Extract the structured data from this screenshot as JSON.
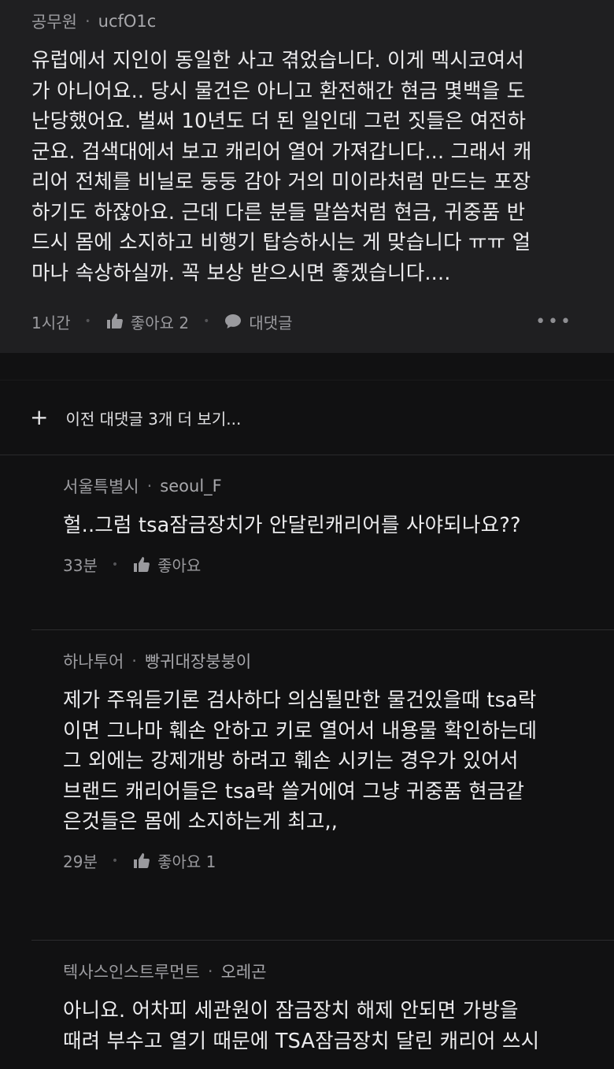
{
  "top_comment": {
    "author": "공무원",
    "nickname": "ucfO1c",
    "body": "유럽에서 지인이 동일한 사고 겪었습니다. 이게 멕시코여서\n가 아니어요.. 당시 물건은 아니고 환전해간 현금 몇백을 도\n난당했어요. 벌써 10년도 더 된 일인데 그런 짓들은 여전하\n군요. 검색대에서 보고 캐리어 열어 가져갑니다... 그래서 캐\n리어 전체를 비닐로 둥둥 감아 거의 미이라처럼 만드는 포장\n하기도 하잖아요. 근데 다른 분들 말씀처럼 현금, 귀중품 반\n드시 몸에 소지하고 비행기 탑승하시는 게 맞습니다 ㅠㅠ 얼\n마나 속상하실까. 꼭 보상 받으시면 좋겠습니다....",
    "time": "1시간",
    "like_label": "좋아요 2",
    "reply_label": "대댓글",
    "more_label": "•••"
  },
  "more_replies": {
    "plus": "+",
    "label": "이전 대댓글 3개 더 보기..."
  },
  "replies": [
    {
      "author": "서울특별시",
      "nickname": "seoul_F",
      "body": "헐..그럼 tsa잠금장치가 안달린캐리어를 사야되나요??",
      "time": "33분",
      "like_label": "좋아요"
    },
    {
      "author": "하나투어",
      "nickname": "빵귀대장붕붕이",
      "body": "제가 주워듣기론 검사하다 의심될만한 물건있을때 tsa락\n이면 그나마 훼손 안하고 키로 열어서 내용물 확인하는데\n그 외에는 강제개방 하려고 훼손 시키는 경우가 있어서\n브랜드 캐리어들은 tsa락 쓸거에여 그냥 귀중품 현금같\n은것들은 몸에 소지하는게 최고,,",
      "time": "29분",
      "like_label": "좋아요 1"
    },
    {
      "author": "텍사스인스트루먼트",
      "nickname": "오레곤",
      "body": "아니요. 어차피 세관원이 잠금장치 해제 안되면 가방을\n때려 부수고 열기 때문에 TSA잠금장치 달린 캐리어 쓰시"
    }
  ],
  "separator": "·",
  "icons": {
    "like": "thumbs-up-icon",
    "reply": "speech-bubble-icon",
    "more": "more-dots-icon"
  }
}
